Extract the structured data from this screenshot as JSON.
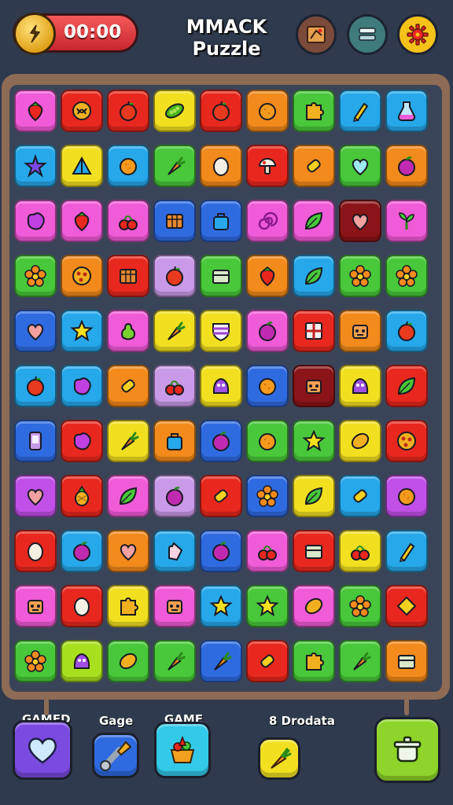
{
  "header": {
    "timer": "00:00",
    "title": "MMACK Puzzle",
    "buttons": [
      {
        "name": "map-button",
        "icon": "map-icon",
        "color": "#7a4a3a"
      },
      {
        "name": "menu-button",
        "icon": "menu-icon",
        "color": "#3f7a7d"
      },
      {
        "name": "settings-button",
        "icon": "gear-icon",
        "color": "#f5c21a"
      }
    ]
  },
  "board": {
    "rows": 11,
    "cols": 9,
    "tiles": [
      [
        {
          "c": "#f05bd8",
          "i": "strawberry"
        },
        {
          "c": "#e8281e",
          "i": "pretzel"
        },
        {
          "c": "#e8281e",
          "i": "apple"
        },
        {
          "c": "#f2e020",
          "i": "pea-pod"
        },
        {
          "c": "#e8281e",
          "i": "apple"
        },
        {
          "c": "#f28a1c",
          "i": "orange"
        },
        {
          "c": "#48c83a",
          "i": "puzzle"
        },
        {
          "c": "#26a8ea",
          "i": "pencil"
        },
        {
          "c": "#26a8ea",
          "i": "potion"
        }
      ],
      [
        {
          "c": "#26a8ea",
          "i": "starfish"
        },
        {
          "c": "#f2e020",
          "i": "tent"
        },
        {
          "c": "#26a8ea",
          "i": "orange"
        },
        {
          "c": "#48c83a",
          "i": "carrot"
        },
        {
          "c": "#f28a1c",
          "i": "egg"
        },
        {
          "c": "#e8281e",
          "i": "mushroom"
        },
        {
          "c": "#f28a1c",
          "i": "candy"
        },
        {
          "c": "#48c83a",
          "i": "heart-gem"
        },
        {
          "c": "#f28a1c",
          "i": "plum"
        }
      ],
      [
        {
          "c": "#f05bd8",
          "i": "blob"
        },
        {
          "c": "#f05bd8",
          "i": "strawberry"
        },
        {
          "c": "#f05bd8",
          "i": "cherry"
        },
        {
          "c": "#2f6be0",
          "i": "crate"
        },
        {
          "c": "#2f6be0",
          "i": "bag"
        },
        {
          "c": "#f05bd8",
          "i": "spiral"
        },
        {
          "c": "#f05bd8",
          "i": "leaf"
        },
        {
          "c": "#8a1418",
          "i": "heart"
        },
        {
          "c": "#f05bd8",
          "i": "sprout"
        }
      ],
      [
        {
          "c": "#48c83a",
          "i": "flower"
        },
        {
          "c": "#f28a1c",
          "i": "pizza"
        },
        {
          "c": "#e8281e",
          "i": "crate"
        },
        {
          "c": "#c89ae8",
          "i": "apple"
        },
        {
          "c": "#48c83a",
          "i": "box"
        },
        {
          "c": "#f28a1c",
          "i": "strawberry"
        },
        {
          "c": "#26a8ea",
          "i": "leaf"
        },
        {
          "c": "#48c83a",
          "i": "flower"
        },
        {
          "c": "#48c83a",
          "i": "flower"
        }
      ],
      [
        {
          "c": "#2f6be0",
          "i": "heart"
        },
        {
          "c": "#26a8ea",
          "i": "star"
        },
        {
          "c": "#f05bd8",
          "i": "pear"
        },
        {
          "c": "#f2e020",
          "i": "carrot"
        },
        {
          "c": "#f2e020",
          "i": "shield"
        },
        {
          "c": "#f05bd8",
          "i": "plum"
        },
        {
          "c": "#e8281e",
          "i": "window"
        },
        {
          "c": "#f28a1c",
          "i": "robot"
        },
        {
          "c": "#26a8ea",
          "i": "apple"
        }
      ],
      [
        {
          "c": "#26a8ea",
          "i": "apple"
        },
        {
          "c": "#26a8ea",
          "i": "blob"
        },
        {
          "c": "#f28a1c",
          "i": "candy"
        },
        {
          "c": "#c89ae8",
          "i": "cherry"
        },
        {
          "c": "#f2e020",
          "i": "monster"
        },
        {
          "c": "#2f6be0",
          "i": "orange"
        },
        {
          "c": "#8a1418",
          "i": "robot"
        },
        {
          "c": "#f2e020",
          "i": "monster"
        },
        {
          "c": "#e8281e",
          "i": "leaf"
        }
      ],
      [
        {
          "c": "#2f6be0",
          "i": "phone"
        },
        {
          "c": "#e8281e",
          "i": "blob"
        },
        {
          "c": "#f2e020",
          "i": "carrot"
        },
        {
          "c": "#f28a1c",
          "i": "bag"
        },
        {
          "c": "#2f6be0",
          "i": "plum"
        },
        {
          "c": "#48c83a",
          "i": "orange"
        },
        {
          "c": "#48c83a",
          "i": "star"
        },
        {
          "c": "#f2e020",
          "i": "lemon"
        },
        {
          "c": "#e8281e",
          "i": "pizza"
        }
      ],
      [
        {
          "c": "#c050e8",
          "i": "heart"
        },
        {
          "c": "#e8281e",
          "i": "pineapple"
        },
        {
          "c": "#f05bd8",
          "i": "leaf"
        },
        {
          "c": "#c89ae8",
          "i": "plum"
        },
        {
          "c": "#e8281e",
          "i": "candy"
        },
        {
          "c": "#2f6be0",
          "i": "flower"
        },
        {
          "c": "#f2e020",
          "i": "leaf"
        },
        {
          "c": "#26a8ea",
          "i": "candy"
        },
        {
          "c": "#c050e8",
          "i": "orange"
        }
      ],
      [
        {
          "c": "#e8281e",
          "i": "egg"
        },
        {
          "c": "#26a8ea",
          "i": "plum"
        },
        {
          "c": "#f28a1c",
          "i": "heart"
        },
        {
          "c": "#26a8ea",
          "i": "hand"
        },
        {
          "c": "#2f6be0",
          "i": "plum"
        },
        {
          "c": "#f05bd8",
          "i": "cherry"
        },
        {
          "c": "#e8281e",
          "i": "box"
        },
        {
          "c": "#f2e020",
          "i": "cherry"
        },
        {
          "c": "#26a8ea",
          "i": "pencil"
        }
      ],
      [
        {
          "c": "#f05bd8",
          "i": "robot"
        },
        {
          "c": "#e8281e",
          "i": "egg"
        },
        {
          "c": "#f2e020",
          "i": "puzzle"
        },
        {
          "c": "#f05bd8",
          "i": "robot"
        },
        {
          "c": "#26a8ea",
          "i": "star"
        },
        {
          "c": "#48c83a",
          "i": "star"
        },
        {
          "c": "#f05bd8",
          "i": "lemon"
        },
        {
          "c": "#48c83a",
          "i": "flower"
        },
        {
          "c": "#e8281e",
          "i": "diamond"
        }
      ],
      [
        {
          "c": "#48c83a",
          "i": "flower"
        },
        {
          "c": "#a8e020",
          "i": "monster"
        },
        {
          "c": "#48c83a",
          "i": "lemon"
        },
        {
          "c": "#48c83a",
          "i": "carrot"
        },
        {
          "c": "#2f6be0",
          "i": "carrot"
        },
        {
          "c": "#e8281e",
          "i": "candy"
        },
        {
          "c": "#48c83a",
          "i": "puzzle"
        },
        {
          "c": "#48c83a",
          "i": "carrot"
        },
        {
          "c": "#f28a1c",
          "i": "box"
        }
      ]
    ]
  },
  "footer": {
    "items": [
      {
        "label": "GAMED",
        "icon": "heart-icon",
        "color": "#7b4ae0"
      },
      {
        "label": "Gage",
        "icon": "wrench-icon",
        "color": "#2f6be0"
      },
      {
        "label": "GAME",
        "icon": "basket-icon",
        "color": "#33c9e8"
      },
      {
        "label": "8 Drodata",
        "icon": "carrot-icon",
        "color": "#f2e020"
      },
      {
        "label": "",
        "icon": "pot-icon",
        "color": "#8ed42a"
      }
    ]
  }
}
